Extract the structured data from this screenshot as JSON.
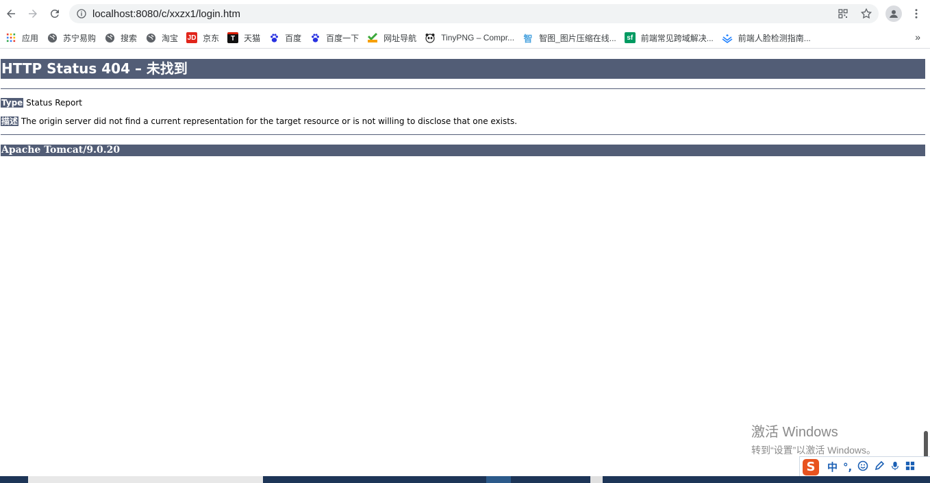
{
  "browser": {
    "url": "localhost:8080/c/xxzx1/login.htm",
    "bookmarks": [
      {
        "label": "应用",
        "icon": "apps-grid-icon"
      },
      {
        "label": "苏宁易购",
        "icon": "globe-icon"
      },
      {
        "label": "搜索",
        "icon": "globe-icon"
      },
      {
        "label": "淘宝",
        "icon": "globe-icon"
      },
      {
        "label": "京东",
        "icon": "jd-icon",
        "badge": "JD",
        "color": "#e1251b"
      },
      {
        "label": "天猫",
        "icon": "tmall-icon",
        "badge": "T",
        "color": "#d81e06"
      },
      {
        "label": "百度",
        "icon": "baidu-paw-icon"
      },
      {
        "label": "百度一下",
        "icon": "baidu-paw-icon"
      },
      {
        "label": "网址导航",
        "icon": "hao-icon"
      },
      {
        "label": "TinyPNG – Compr...",
        "icon": "panda-icon"
      },
      {
        "label": "智图_图片压缩在线...",
        "icon": "zhitu-icon",
        "badge": "智",
        "color": "#4aa3df"
      },
      {
        "label": "前端常见跨域解决...",
        "icon": "sf-icon",
        "badge": "sf",
        "color": "#009a61"
      },
      {
        "label": "前端人脸检测指南...",
        "icon": "juejin-icon"
      }
    ],
    "more_label": "»"
  },
  "page": {
    "title": "HTTP Status 404 – 未找到",
    "type_label": "Type",
    "type_value": "Status Report",
    "desc_label": "描述",
    "desc_value": "The origin server did not find a current representation for the target resource or is not willing to disclose that one exists.",
    "footer": "Apache Tomcat/9.0.20"
  },
  "watermark": {
    "line1": "激活 Windows",
    "line2": "转到“设置”以激活 Windows。"
  },
  "ime": {
    "logo": "S",
    "lang": "中",
    "punct": "°,"
  },
  "colors": {
    "tomcat_header": "#525d76",
    "omnibox": "#f1f3f4"
  }
}
